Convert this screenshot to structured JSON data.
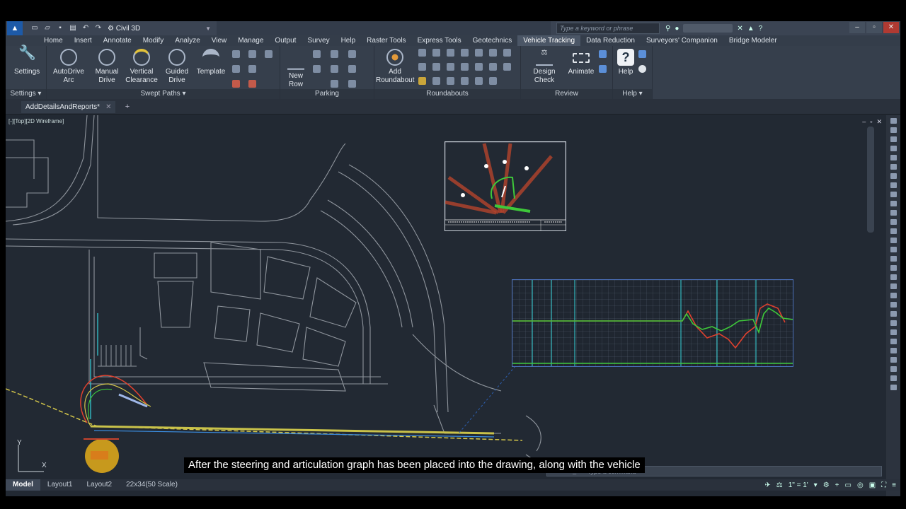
{
  "titlebar": {
    "logo": "C3D",
    "workspace": "Civil 3D",
    "search_placeholder": "Type a keyword or phrase"
  },
  "tabs": [
    "Home",
    "Insert",
    "Annotate",
    "Modify",
    "Analyze",
    "View",
    "Manage",
    "Output",
    "Survey",
    "Help",
    "Raster Tools",
    "Express Tools",
    "Geotechnics",
    "Vehicle Tracking",
    "Data Reduction",
    "Surveyors' Companion",
    "Bridge Modeler"
  ],
  "active_tab": "Vehicle Tracking",
  "ribbon": {
    "settings": {
      "label": "Settings",
      "panel": "Settings"
    },
    "swept": {
      "panel": "Swept Paths",
      "items": [
        "AutoDrive Arc",
        "Manual Drive",
        "Vertical Clearance",
        "Guided Drive",
        "Template"
      ]
    },
    "parking": {
      "panel": "Parking",
      "new_row": "New Row"
    },
    "roundabouts": {
      "panel": "Roundabouts",
      "add": "Add Roundabout"
    },
    "review": {
      "panel": "Review",
      "items": [
        "Design Check",
        "Animate"
      ]
    },
    "help": {
      "panel": "Help",
      "label": "Help"
    }
  },
  "filetab": {
    "name": "AddDetailsAndReports*"
  },
  "viewport": {
    "label": "[-][Top][2D Wireframe]"
  },
  "command": {
    "placeholder": "Type a command"
  },
  "layouts": [
    "Model",
    "Layout1",
    "Layout2",
    "22x34(50 Scale)"
  ],
  "status": {
    "scale": "1\" = 1'"
  },
  "ucs": {
    "x": "X",
    "y": "Y"
  },
  "caption": "After the steering and articulation graph has been placed into the drawing, along with the vehicle",
  "colors": {
    "accent": "#1d5aa8",
    "bg": "#222933",
    "graph_red": "#e0412e",
    "graph_green": "#3ec83a",
    "graph_cyan": "#35d3d8"
  }
}
